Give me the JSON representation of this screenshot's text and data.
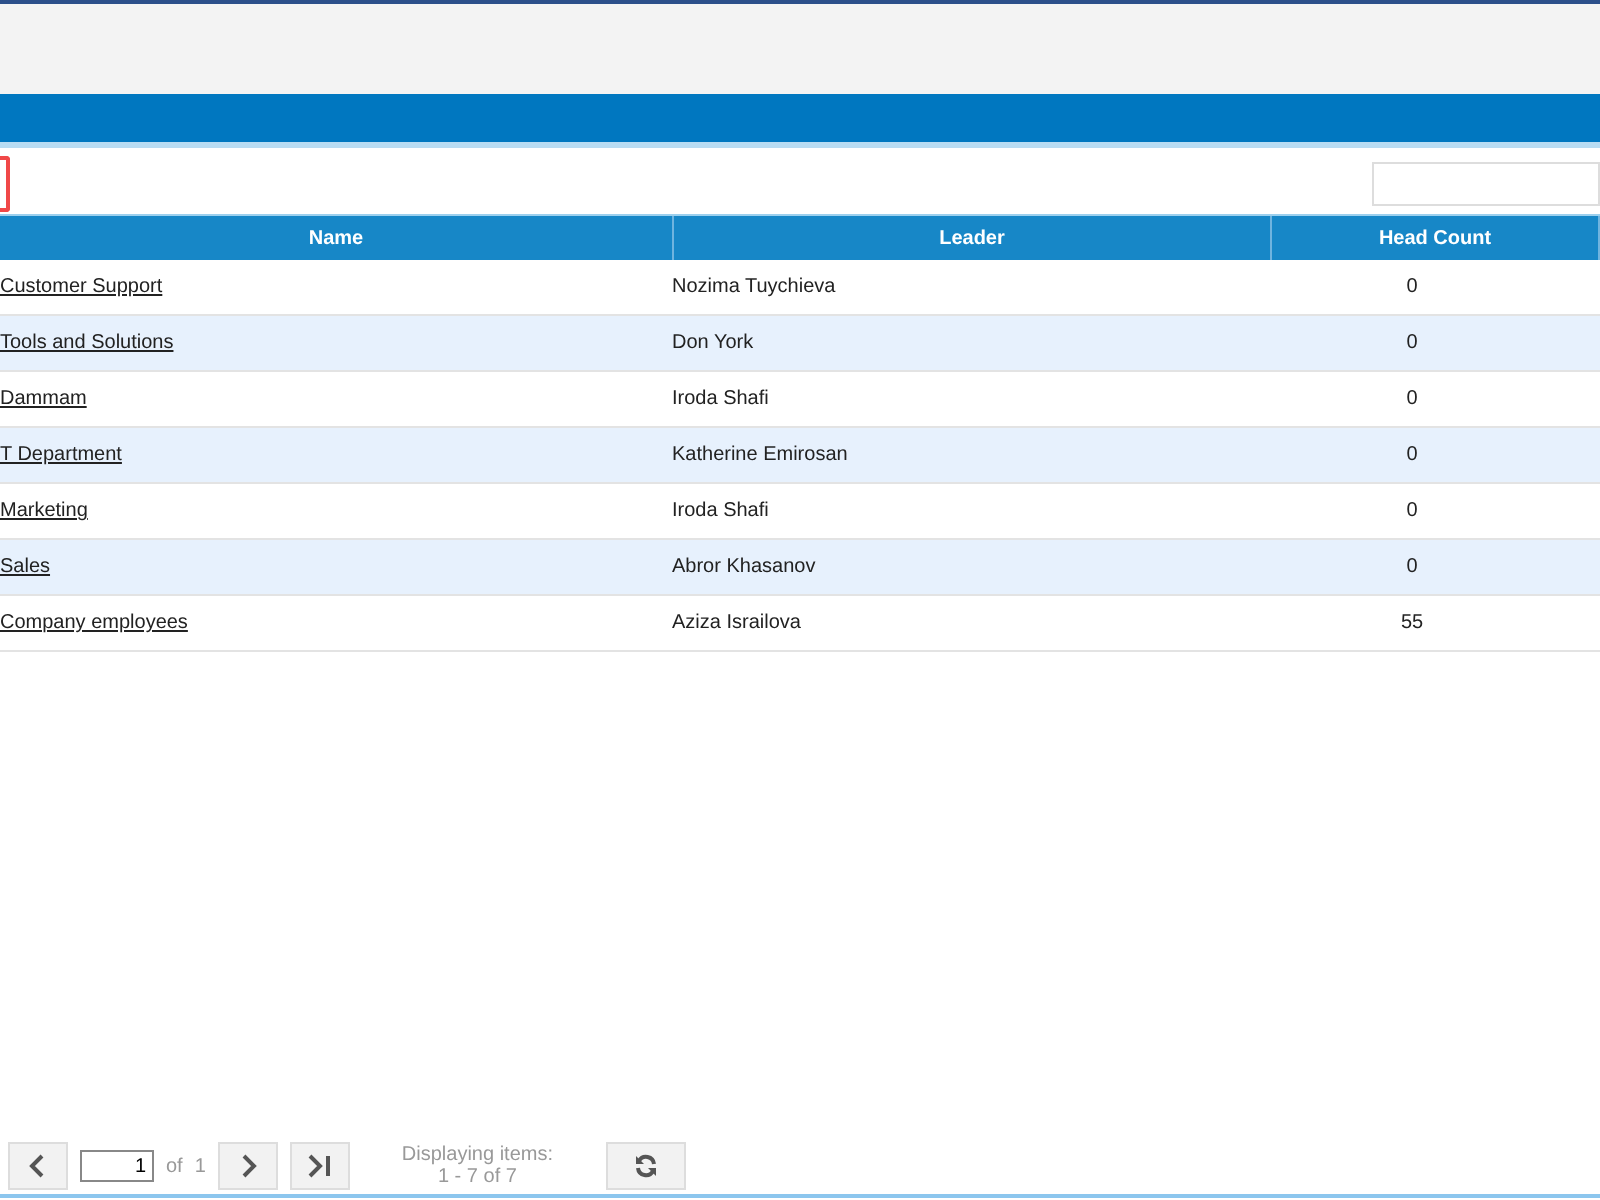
{
  "table": {
    "columns": [
      "Name",
      "Leader",
      "Head Count"
    ],
    "rows": [
      {
        "name": "Customer Support",
        "leader": "Nozima Tuychieva",
        "head_count": "0"
      },
      {
        "name": "Tools and Solutions",
        "leader": "Don York",
        "head_count": "0"
      },
      {
        "name": "Dammam",
        "leader": "Iroda Shafi",
        "head_count": "0"
      },
      {
        "name": "T Department",
        "leader": "Katherine Emirosan",
        "head_count": "0"
      },
      {
        "name": "Marketing",
        "leader": "Iroda Shafi",
        "head_count": "0"
      },
      {
        "name": "Sales",
        "leader": "Abror Khasanov",
        "head_count": "0"
      },
      {
        "name": "Company employees",
        "leader": "Aziza Israilova",
        "head_count": "55"
      }
    ]
  },
  "pager": {
    "page": "1",
    "of_label": "of",
    "total_pages": "1",
    "display_label": "Displaying items:",
    "display_range": "1 - 7 of 7"
  }
}
